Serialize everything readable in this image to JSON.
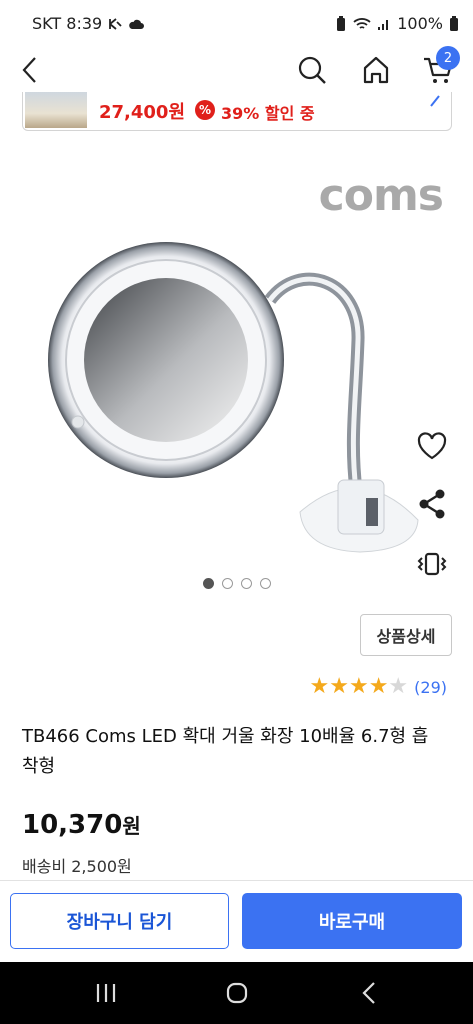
{
  "status_bar": {
    "carrier_time": "SKT 8:39",
    "battery": "100%"
  },
  "nav": {
    "cart_count": "2"
  },
  "promo": {
    "price": "27,400원",
    "badge": "%",
    "discount": "39% 할인 중"
  },
  "product": {
    "brand": "coms",
    "title": "TB466 Coms LED 확대 거울 화장 10배율 6.7형 흡착형",
    "price": "10,370",
    "price_unit": "원",
    "shipping": "배송비 2,500원",
    "detail_button": "상품상세",
    "rating": {
      "value": 4,
      "max": 5,
      "count": "(29)"
    },
    "image_count": 4,
    "active_image": 0
  },
  "actions": {
    "add_to_cart": "장바구니 담기",
    "buy_now": "바로구매"
  },
  "colors": {
    "accent": "#3b72f2",
    "sale": "#e0201b",
    "star": "#f4a91c"
  },
  "icons": [
    "back-arrow-icon",
    "search-icon",
    "home-icon",
    "cart-icon",
    "heart-icon",
    "share-icon",
    "vibrate-icon"
  ]
}
